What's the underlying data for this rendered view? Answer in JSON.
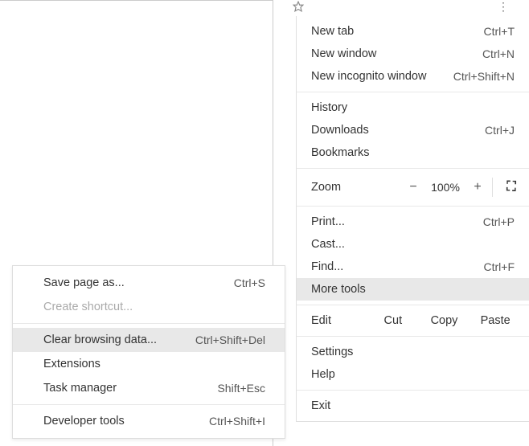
{
  "main_menu": {
    "new_tab": {
      "label": "New tab",
      "shortcut": "Ctrl+T"
    },
    "new_window": {
      "label": "New window",
      "shortcut": "Ctrl+N"
    },
    "new_incognito": {
      "label": "New incognito window",
      "shortcut": "Ctrl+Shift+N"
    },
    "history": {
      "label": "History"
    },
    "downloads": {
      "label": "Downloads",
      "shortcut": "Ctrl+J"
    },
    "bookmarks": {
      "label": "Bookmarks"
    },
    "zoom": {
      "label": "Zoom",
      "minus": "−",
      "percent": "100%",
      "plus": "+"
    },
    "print": {
      "label": "Print...",
      "shortcut": "Ctrl+P"
    },
    "cast": {
      "label": "Cast..."
    },
    "find": {
      "label": "Find...",
      "shortcut": "Ctrl+F"
    },
    "more_tools": {
      "label": "More tools"
    },
    "edit": {
      "label": "Edit",
      "cut": "Cut",
      "copy": "Copy",
      "paste": "Paste"
    },
    "settings": {
      "label": "Settings"
    },
    "help": {
      "label": "Help"
    },
    "exit": {
      "label": "Exit"
    }
  },
  "submenu": {
    "save_page": {
      "label": "Save page as...",
      "shortcut": "Ctrl+S"
    },
    "create_shortcut": {
      "label": "Create shortcut..."
    },
    "clear_browsing": {
      "label": "Clear browsing data...",
      "shortcut": "Ctrl+Shift+Del"
    },
    "extensions": {
      "label": "Extensions"
    },
    "task_manager": {
      "label": "Task manager",
      "shortcut": "Shift+Esc"
    },
    "developer_tools": {
      "label": "Developer tools",
      "shortcut": "Ctrl+Shift+I"
    }
  }
}
